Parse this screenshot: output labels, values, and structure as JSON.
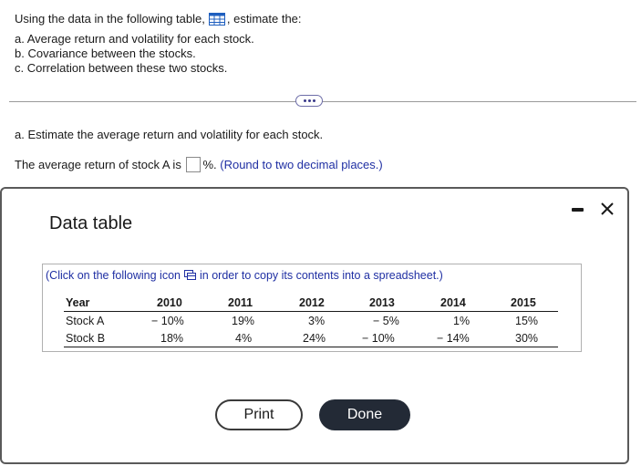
{
  "question": {
    "intro_before": "Using the data in the following table,",
    "intro_after": ", estimate the:",
    "items": [
      "a. Average return and volatility for each stock.",
      "b. Covariance between the stocks.",
      "c. Correlation between these two stocks."
    ]
  },
  "part_a": {
    "heading": "a. Estimate the average return and volatility for each stock.",
    "prompt_before": "The average return of stock A is",
    "prompt_after": "%.",
    "hint": "(Round to two decimal places.)",
    "answer_value": ""
  },
  "modal": {
    "title": "Data table",
    "copy_note_before": "(Click on the following icon",
    "copy_note_after": "in order to copy its contents into a spreadsheet.)",
    "table": {
      "header": [
        "Year",
        "2010",
        "2011",
        "2012",
        "2013",
        "2014",
        "2015"
      ],
      "rows": [
        [
          "Stock A",
          "− 10%",
          "19%",
          "3%",
          "− 5%",
          "1%",
          "15%"
        ],
        [
          "Stock B",
          "18%",
          "4%",
          "24%",
          "− 10%",
          "− 14%",
          "30%"
        ]
      ]
    },
    "print_label": "Print",
    "done_label": "Done"
  },
  "icons": [
    "table-grid-icon",
    "more-dots-icon",
    "minimize-icon",
    "close-icon",
    "copy-spreadsheet-icon"
  ],
  "colors": {
    "hint_blue": "#1f2fa3",
    "done_button": "#232a36",
    "grid_icon_blue": "#1f5fbf"
  }
}
